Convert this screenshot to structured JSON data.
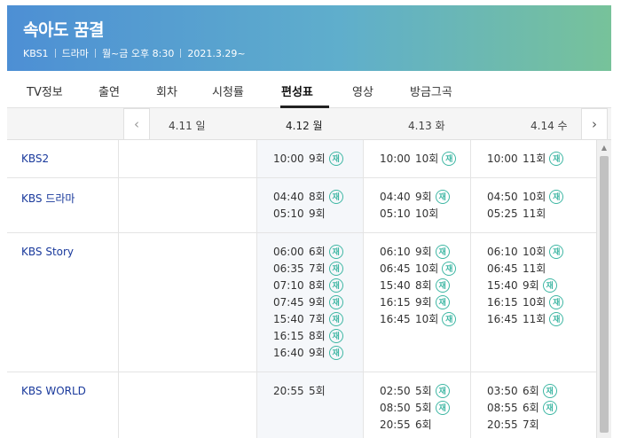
{
  "program": {
    "title": "속아도 꿈결",
    "channel": "KBS1",
    "genre": "드라마",
    "airtime": "월~금 오후 8:30",
    "start_date": "2021.3.29~"
  },
  "tabs": [
    "TV정보",
    "출연",
    "회차",
    "시청률",
    "편성표",
    "영상",
    "방금그곡"
  ],
  "active_tab": "편성표",
  "dates": [
    "4.11 일",
    "4.12 월",
    "4.13 화",
    "4.14 수"
  ],
  "active_date": "4.12 월",
  "rerun_label": "재",
  "schedule": [
    {
      "channel": "KBS2",
      "days": [
        [],
        [
          {
            "time": "10:00",
            "ep": "9회",
            "rerun": true
          }
        ],
        [
          {
            "time": "10:00",
            "ep": "10회",
            "rerun": true
          }
        ],
        [
          {
            "time": "10:00",
            "ep": "11회",
            "rerun": true
          }
        ]
      ]
    },
    {
      "channel": "KBS 드라마",
      "days": [
        [],
        [
          {
            "time": "04:40",
            "ep": "8회",
            "rerun": true
          },
          {
            "time": "05:10",
            "ep": "9회",
            "rerun": false
          }
        ],
        [
          {
            "time": "04:40",
            "ep": "9회",
            "rerun": true
          },
          {
            "time": "05:10",
            "ep": "10회",
            "rerun": false
          }
        ],
        [
          {
            "time": "04:50",
            "ep": "10회",
            "rerun": true
          },
          {
            "time": "05:25",
            "ep": "11회",
            "rerun": false
          }
        ]
      ]
    },
    {
      "channel": "KBS Story",
      "days": [
        [],
        [
          {
            "time": "06:00",
            "ep": "6회",
            "rerun": true
          },
          {
            "time": "06:35",
            "ep": "7회",
            "rerun": true
          },
          {
            "time": "07:10",
            "ep": "8회",
            "rerun": true
          },
          {
            "time": "07:45",
            "ep": "9회",
            "rerun": true
          },
          {
            "time": "15:40",
            "ep": "7회",
            "rerun": true
          },
          {
            "time": "16:15",
            "ep": "8회",
            "rerun": true
          },
          {
            "time": "16:40",
            "ep": "9회",
            "rerun": true
          }
        ],
        [
          {
            "time": "06:10",
            "ep": "9회",
            "rerun": true
          },
          {
            "time": "06:45",
            "ep": "10회",
            "rerun": true
          },
          {
            "time": "15:40",
            "ep": "8회",
            "rerun": true
          },
          {
            "time": "16:15",
            "ep": "9회",
            "rerun": true
          },
          {
            "time": "16:45",
            "ep": "10회",
            "rerun": true
          }
        ],
        [
          {
            "time": "06:10",
            "ep": "10회",
            "rerun": true
          },
          {
            "time": "06:45",
            "ep": "11회",
            "rerun": false
          },
          {
            "time": "15:40",
            "ep": "9회",
            "rerun": true
          },
          {
            "time": "16:15",
            "ep": "10회",
            "rerun": true
          },
          {
            "time": "16:45",
            "ep": "11회",
            "rerun": true
          }
        ]
      ]
    },
    {
      "channel": "KBS WORLD",
      "days": [
        [],
        [
          {
            "time": "20:55",
            "ep": "5회",
            "rerun": false
          }
        ],
        [
          {
            "time": "02:50",
            "ep": "5회",
            "rerun": true
          },
          {
            "time": "08:50",
            "ep": "5회",
            "rerun": true
          },
          {
            "time": "20:55",
            "ep": "6회",
            "rerun": false
          }
        ],
        [
          {
            "time": "03:50",
            "ep": "6회",
            "rerun": true
          },
          {
            "time": "08:55",
            "ep": "6회",
            "rerun": true
          },
          {
            "time": "20:55",
            "ep": "7회",
            "rerun": false
          }
        ]
      ]
    }
  ],
  "colors": {
    "header_gradient_start": "#4d8fd4",
    "header_gradient_end": "#77c29a",
    "channel_link": "#1a3a9c",
    "rerun_badge": "#3fb7a4"
  }
}
